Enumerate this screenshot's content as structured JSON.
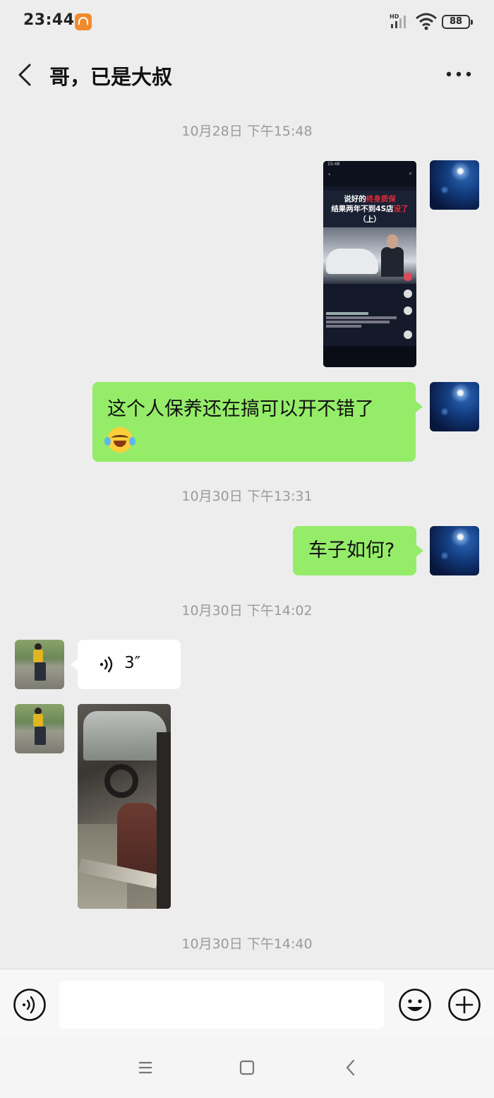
{
  "status_bar": {
    "time": "23:44",
    "battery": "88",
    "icons": [
      "app-notification-icon",
      "hd-signal-icon",
      "wifi-icon",
      "battery-icon"
    ]
  },
  "header": {
    "title": "哥，已是大叔",
    "back_icon": "chevron-left-icon",
    "more_icon": "more-dots-icon"
  },
  "messages": {
    "ts1": "10月28日 下午15:48",
    "shot": {
      "time": "15:48",
      "line1_a": "说好的",
      "line1_b": "终身质保",
      "line2_a": "结果两年不到4S店",
      "line2_b": "没了",
      "line3": "（上）"
    },
    "text1": "这个人保养还在搞可以开不错了",
    "ts2": "10月30日 下午13:31",
    "text2": "车子如何?",
    "ts3": "10月30日 下午14:02",
    "voice_duration": "3″",
    "ts4": "10月30日 下午14:40"
  },
  "colors": {
    "background": "#ededed",
    "sent_bubble": "#95ec69",
    "received_bubble": "#ffffff",
    "timestamp": "#9a9a9a"
  },
  "input_bar": {
    "voice_icon": "voice-mode-icon",
    "emoji_icon": "emoji-icon",
    "plus_icon": "plus-circle-icon"
  },
  "nav_bar": {
    "icons": [
      "menu-icon",
      "home-square-icon",
      "back-icon"
    ]
  }
}
